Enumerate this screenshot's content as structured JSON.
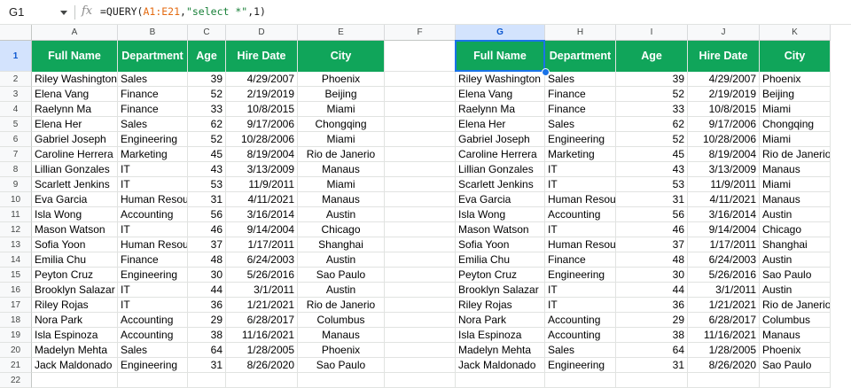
{
  "formula_bar": {
    "cell_ref": "G1",
    "fx_label": "fx",
    "formula_prefix": "=QUERY(",
    "formula_range": "A1:E21",
    "formula_mid": ",",
    "formula_string": "\"select *\"",
    "formula_suffix": ",1)"
  },
  "columns": [
    "A",
    "B",
    "C",
    "D",
    "E",
    "F",
    "G",
    "H",
    "I",
    "J",
    "K"
  ],
  "selected_column": "G",
  "rows": [
    "1",
    "2",
    "3",
    "4",
    "5",
    "6",
    "7",
    "8",
    "9",
    "10",
    "11",
    "12",
    "13",
    "14",
    "15",
    "16",
    "17",
    "18",
    "19",
    "20",
    "21",
    "22"
  ],
  "selected_row": "1",
  "left_table": {
    "headers": [
      "Full Name",
      "Department",
      "Age",
      "Hire Date",
      "City"
    ],
    "rows": [
      [
        "Riley Washington",
        "Sales",
        "39",
        "4/29/2007",
        "Phoenix"
      ],
      [
        "Elena Vang",
        "Finance",
        "52",
        "2/19/2019",
        "Beijing"
      ],
      [
        "Raelynn Ma",
        "Finance",
        "33",
        "10/8/2015",
        "Miami"
      ],
      [
        "Elena Her",
        "Sales",
        "62",
        "9/17/2006",
        "Chongqing"
      ],
      [
        "Gabriel Joseph",
        "Engineering",
        "52",
        "10/28/2006",
        "Miami"
      ],
      [
        "Caroline Herrera",
        "Marketing",
        "45",
        "8/19/2004",
        "Rio de Janerio"
      ],
      [
        "Lillian Gonzales",
        "IT",
        "43",
        "3/13/2009",
        "Manaus"
      ],
      [
        "Scarlett Jenkins",
        "IT",
        "53",
        "11/9/2011",
        "Miami"
      ],
      [
        "Eva Garcia",
        "Human Resourc",
        "31",
        "4/11/2021",
        "Manaus"
      ],
      [
        "Isla Wong",
        "Accounting",
        "56",
        "3/16/2014",
        "Austin"
      ],
      [
        "Mason Watson",
        "IT",
        "46",
        "9/14/2004",
        "Chicago"
      ],
      [
        "Sofia Yoon",
        "Human Resourc",
        "37",
        "1/17/2011",
        "Shanghai"
      ],
      [
        "Emilia Chu",
        "Finance",
        "48",
        "6/24/2003",
        "Austin"
      ],
      [
        "Peyton Cruz",
        "Engineering",
        "30",
        "5/26/2016",
        "Sao Paulo"
      ],
      [
        "Brooklyn Salazar",
        "IT",
        "44",
        "3/1/2011",
        "Austin"
      ],
      [
        "Riley Rojas",
        "IT",
        "36",
        "1/21/2021",
        "Rio de Janerio"
      ],
      [
        "Nora Park",
        "Accounting",
        "29",
        "6/28/2017",
        "Columbus"
      ],
      [
        "Isla Espinoza",
        "Accounting",
        "38",
        "11/16/2021",
        "Manaus"
      ],
      [
        "Madelyn Mehta",
        "Sales",
        "64",
        "1/28/2005",
        "Phoenix"
      ],
      [
        "Jack Maldonado",
        "Engineering",
        "31",
        "8/26/2020",
        "Sao Paulo"
      ]
    ]
  },
  "right_table": {
    "headers": [
      "Full Name",
      "Department",
      "Age",
      "Hire Date",
      "City"
    ],
    "rows": [
      [
        "Riley Washington",
        "Sales",
        "39",
        "4/29/2007",
        "Phoenix"
      ],
      [
        "Elena Vang",
        "Finance",
        "52",
        "2/19/2019",
        "Beijing"
      ],
      [
        "Raelynn Ma",
        "Finance",
        "33",
        "10/8/2015",
        "Miami"
      ],
      [
        "Elena Her",
        "Sales",
        "62",
        "9/17/2006",
        "Chongqing"
      ],
      [
        "Gabriel Joseph",
        "Engineering",
        "52",
        "10/28/2006",
        "Miami"
      ],
      [
        "Caroline Herrera",
        "Marketing",
        "45",
        "8/19/2004",
        "Rio de Janerio"
      ],
      [
        "Lillian Gonzales",
        "IT",
        "43",
        "3/13/2009",
        "Manaus"
      ],
      [
        "Scarlett Jenkins",
        "IT",
        "53",
        "11/9/2011",
        "Miami"
      ],
      [
        "Eva Garcia",
        "Human Resourc",
        "31",
        "4/11/2021",
        "Manaus"
      ],
      [
        "Isla Wong",
        "Accounting",
        "56",
        "3/16/2014",
        "Austin"
      ],
      [
        "Mason Watson",
        "IT",
        "46",
        "9/14/2004",
        "Chicago"
      ],
      [
        "Sofia Yoon",
        "Human Resourc",
        "37",
        "1/17/2011",
        "Shanghai"
      ],
      [
        "Emilia Chu",
        "Finance",
        "48",
        "6/24/2003",
        "Austin"
      ],
      [
        "Peyton Cruz",
        "Engineering",
        "30",
        "5/26/2016",
        "Sao Paulo"
      ],
      [
        "Brooklyn Salazar",
        "IT",
        "44",
        "3/1/2011",
        "Austin"
      ],
      [
        "Riley Rojas",
        "IT",
        "36",
        "1/21/2021",
        "Rio de Janerio"
      ],
      [
        "Nora Park",
        "Accounting",
        "29",
        "6/28/2017",
        "Columbus"
      ],
      [
        "Isla Espinoza",
        "Accounting",
        "38",
        "11/16/2021",
        "Manaus"
      ],
      [
        "Madelyn Mehta",
        "Sales",
        "64",
        "1/28/2005",
        "Phoenix"
      ],
      [
        "Jack Maldonado",
        "Engineering",
        "31",
        "8/26/2020",
        "Sao Paulo"
      ]
    ]
  },
  "colors": {
    "header_green": "#10a55a",
    "selection_blue": "#1a73e8"
  }
}
